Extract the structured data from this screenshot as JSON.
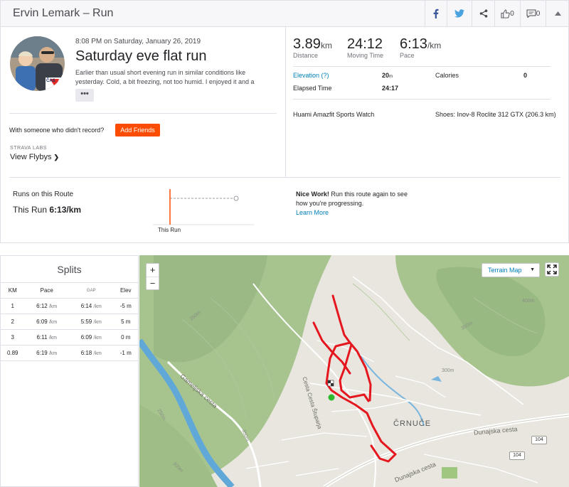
{
  "header": {
    "title": "Ervin Lemark – Run",
    "kudos_count": "0",
    "comments_count": "0"
  },
  "activity": {
    "date": "8:08 PM on Saturday, January 26, 2019",
    "title": "Saturday eve flat run",
    "description": "Earlier than usual short evening run in similar conditions like yesterday. Cold, a bit freezing, not too humid. I enjoyed it and a",
    "more_label": "•••",
    "with_someone": "With someone who didn't record?",
    "add_friends": "Add Friends",
    "labs_label": "STRAVA LABS",
    "flybys_label": "View Flybys",
    "avatar_badge": "ČAS"
  },
  "stats": {
    "distance": {
      "value": "3.89",
      "unit": "km",
      "label": "Distance"
    },
    "moving_time": {
      "value": "24:12",
      "label": "Moving Time"
    },
    "pace": {
      "value": "6:13",
      "unit": "/km",
      "label": "Pace"
    },
    "elevation_label": "Elevation (?)",
    "elevation_value": "20",
    "elevation_unit": "m",
    "calories_label": "Calories",
    "calories_value": "0",
    "elapsed_label": "Elapsed Time",
    "elapsed_value": "24:17",
    "device": "Huami Amazfit Sports Watch",
    "shoes": "Shoes: Inov-8 Roclite 312 GTX (206.3 km)"
  },
  "route": {
    "runs_on_route": "Runs on this Route",
    "this_run_prefix": "This Run",
    "this_run_pace": "6:13/km",
    "chart_label": "This Run",
    "nice_bold": "Nice Work!",
    "nice_text": "Run this route again to see how you're progressing.",
    "learn_more": "Learn More"
  },
  "splits": {
    "title": "Splits",
    "headers": [
      "KM",
      "Pace",
      "GAP",
      "Elev"
    ],
    "pace_unit": "/km",
    "rows": [
      {
        "km": "1",
        "pace": "6:12",
        "gap": "6:14",
        "elev": "-5",
        "elev_unit": "m"
      },
      {
        "km": "2",
        "pace": "6:09",
        "gap": "5:59",
        "elev": "5",
        "elev_unit": "m"
      },
      {
        "km": "3",
        "pace": "6:11",
        "gap": "6:09",
        "elev": "0",
        "elev_unit": "m"
      },
      {
        "km": "0.89",
        "pace": "6:19",
        "gap": "6:18",
        "elev": "-1",
        "elev_unit": "m"
      }
    ]
  },
  "map": {
    "zoom_in": "+",
    "zoom_out": "−",
    "terrain_label": "Terrain Map",
    "terrain_caret": "▼",
    "labels": {
      "gamelj": "Gameljska cesta",
      "stuparja": "Cesta Cesta Štuparja",
      "crnuce": "ČRNUČE",
      "dunajska1": "Dunajska cesta",
      "dunajska2": "Dunajska cesta",
      "shield1": "104",
      "shield2": "104",
      "c250a": "250m",
      "c250b": "250m",
      "c300a": "300m",
      "c300b": "300m",
      "c350a": "350m",
      "c350b": "350m",
      "c400": "400m"
    },
    "colors": {
      "route": "#e5161e",
      "start": "#2db82d",
      "water": "#5fa8d8",
      "forest": "#9fbe86"
    }
  }
}
